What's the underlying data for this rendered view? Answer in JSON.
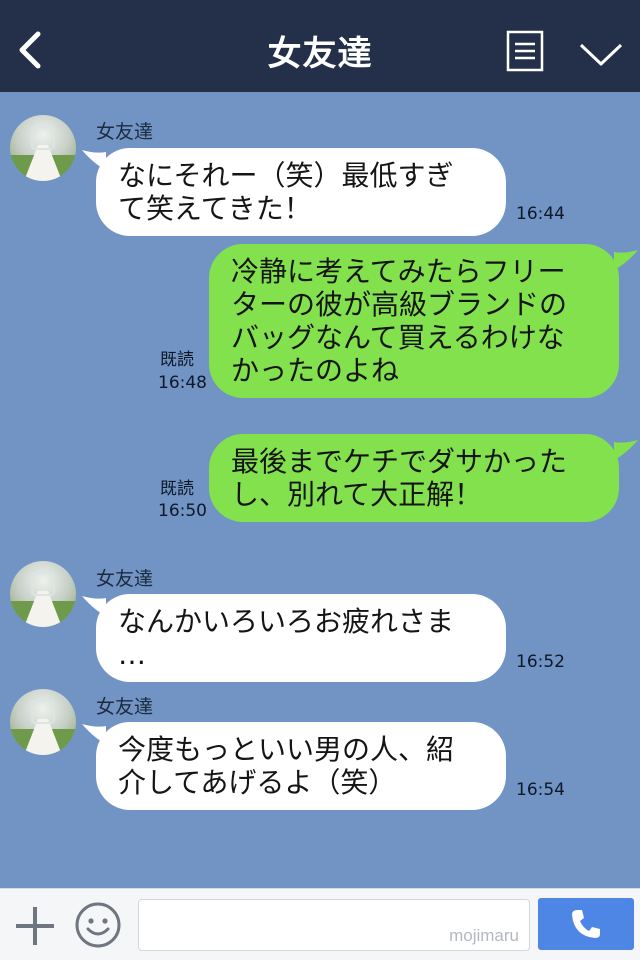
{
  "header": {
    "title": "女友達",
    "icons": [
      "back-icon",
      "list-icon",
      "chevron-down-icon"
    ]
  },
  "colors": {
    "header_bg": "#243049",
    "chat_bg": "#7194c5",
    "incoming_bubble": "#ffffff",
    "outgoing_bubble": "#82e14d",
    "call_button": "#4e86e6"
  },
  "messages": [
    {
      "direction": "in",
      "sender": "女友達",
      "lines": [
        "なにそれー（笑）最低すぎ",
        "て笑えてきた！"
      ],
      "time": "16:44"
    },
    {
      "direction": "out",
      "read": "既読",
      "lines": [
        "冷静に考えてみたらフリー",
        "ターの彼が高級ブランドの",
        "バッグなんて買えるわけな",
        "かったのよね"
      ],
      "time": "16:48"
    },
    {
      "direction": "out",
      "read": "既読",
      "lines": [
        "最後までケチでダサかった",
        "し、別れて大正解！"
      ],
      "time": "16:50"
    },
    {
      "direction": "in",
      "sender": "女友達",
      "lines": [
        "なんかいろいろお疲れさま",
        "…"
      ],
      "time": "16:52"
    },
    {
      "direction": "in",
      "sender": "女友達",
      "lines": [
        "今度もっといい男の人、紹",
        "介してあげるよ（笑）"
      ],
      "time": "16:54"
    }
  ],
  "input_bar": {
    "watermark": "mojimaru",
    "icons": [
      "plus-icon",
      "smiley-icon",
      "phone-icon"
    ]
  }
}
